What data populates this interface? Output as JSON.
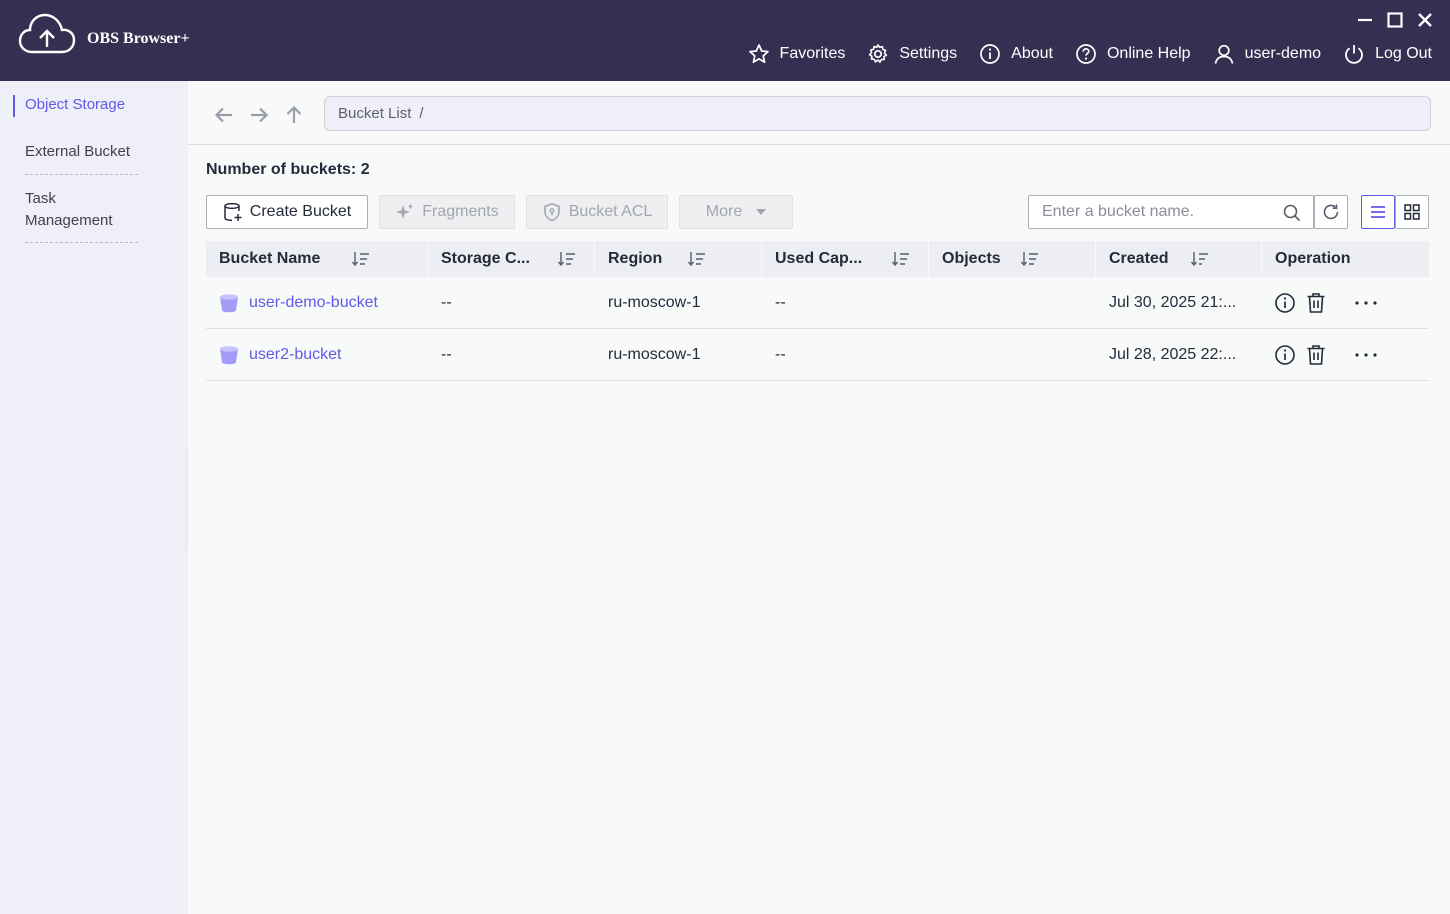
{
  "app": {
    "title": "OBS Browser+"
  },
  "topnav": {
    "favorites": "Favorites",
    "settings": "Settings",
    "about": "About",
    "online_help": "Online Help",
    "user": "user-demo",
    "logout": "Log Out"
  },
  "sidebar": {
    "items": [
      {
        "label": "Object Storage",
        "active": true
      },
      {
        "label": "External Bucket",
        "active": false
      },
      {
        "label": "Task Management",
        "active": false
      }
    ]
  },
  "breadcrumb": {
    "root": "Bucket List",
    "separator": "/"
  },
  "summary": {
    "bucket_count_label": "Number of buckets: 2"
  },
  "toolbar": {
    "create_bucket": "Create Bucket",
    "fragments": "Fragments",
    "bucket_acl": "Bucket ACL",
    "more": "More"
  },
  "search": {
    "placeholder": "Enter a bucket name.",
    "value": ""
  },
  "table": {
    "columns": [
      "Bucket Name",
      "Storage C...",
      "Region",
      "Used Cap...",
      "Objects",
      "Created",
      "Operation"
    ],
    "rows": [
      {
        "name": "user-demo-bucket",
        "storage_class": "--",
        "region": "ru-moscow-1",
        "used_capacity": "--",
        "objects": "",
        "created": "Jul 30, 2025 21:..."
      },
      {
        "name": "user2-bucket",
        "storage_class": "--",
        "region": "ru-moscow-1",
        "used_capacity": "--",
        "objects": "",
        "created": "Jul 28, 2025 22:..."
      }
    ]
  },
  "colors": {
    "titlebar": "#353052",
    "accent": "#5e5ae6",
    "bucket_icon": "#a29bf8"
  },
  "view_mode": "list"
}
